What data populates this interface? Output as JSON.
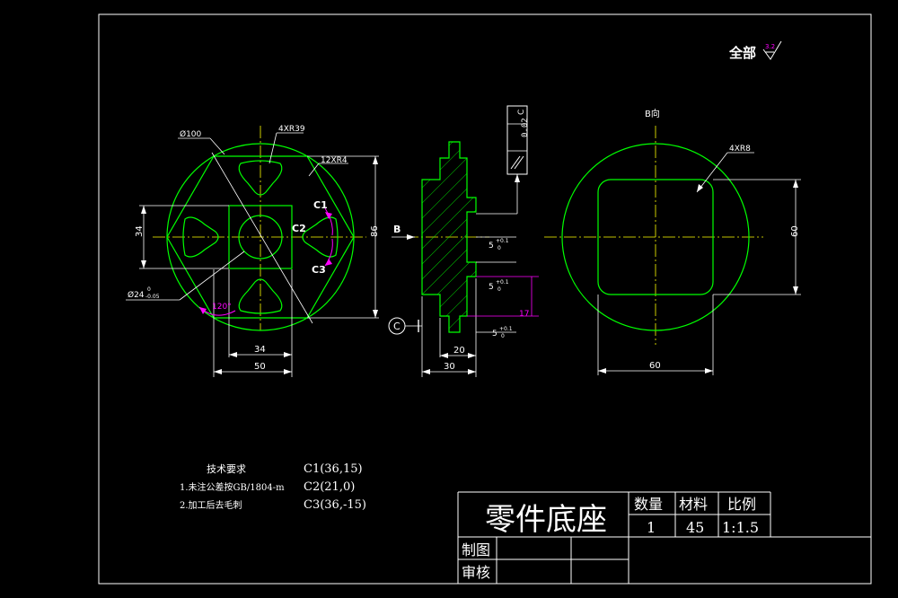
{
  "header": {
    "roughness_label": "全部",
    "roughness_value": "3.2"
  },
  "front_view": {
    "dia_label": "Ø100",
    "r39_label": "4XR39",
    "r4_label": "12XR4",
    "c1_label": "C1",
    "c2_label": "C2",
    "c3_label": "C3",
    "dim_34_v": "34",
    "dim_86": "86",
    "bore_label": "Ø24",
    "bore_tol_upper": "0",
    "bore_tol_lower": "-0.05",
    "angle_label": "120°",
    "dim_34_h": "34",
    "dim_50": "50"
  },
  "section_view": {
    "flatness_tol": "0.02",
    "datum_in_frame": "C",
    "datum_marker": "C",
    "view_arrow": "B",
    "dim_5a": "5",
    "dim_5a_tol_upper": "+0.1",
    "dim_5a_tol_lower": "0",
    "dim_5b": "5",
    "dim_5b_tol_upper": "+0.1",
    "dim_5b_tol_lower": "0",
    "dim_17": "17",
    "dim_5c": "5",
    "dim_5c_tol_upper": "+0.1",
    "dim_5c_tol_lower": "0",
    "dim_20": "20",
    "dim_30": "30"
  },
  "b_view": {
    "title": "B向",
    "r8_label": "4XR8",
    "dim_60_v": "60",
    "dim_60_h": "60"
  },
  "tech_requirements": {
    "title": "技术要求",
    "item1": "1.未注公差按GB/1804-m",
    "item2": "2.加工后去毛刺"
  },
  "coords": {
    "c1": "C1(36,15)",
    "c2": "C2(21,0)",
    "c3": "C3(36,-15)"
  },
  "title_block": {
    "part_name": "零件底座",
    "qty_label": "数量",
    "material_label": "材料",
    "scale_label": "比例",
    "qty_value": "1",
    "material_value": "45",
    "scale_value": "1:1.5",
    "drawn_label": "制图",
    "checked_label": "审核"
  },
  "colors": {
    "green": "#00ff00",
    "magenta": "#ff00ff",
    "white": "#ffffff",
    "yellow": "#ffff00",
    "background": "#000000"
  }
}
